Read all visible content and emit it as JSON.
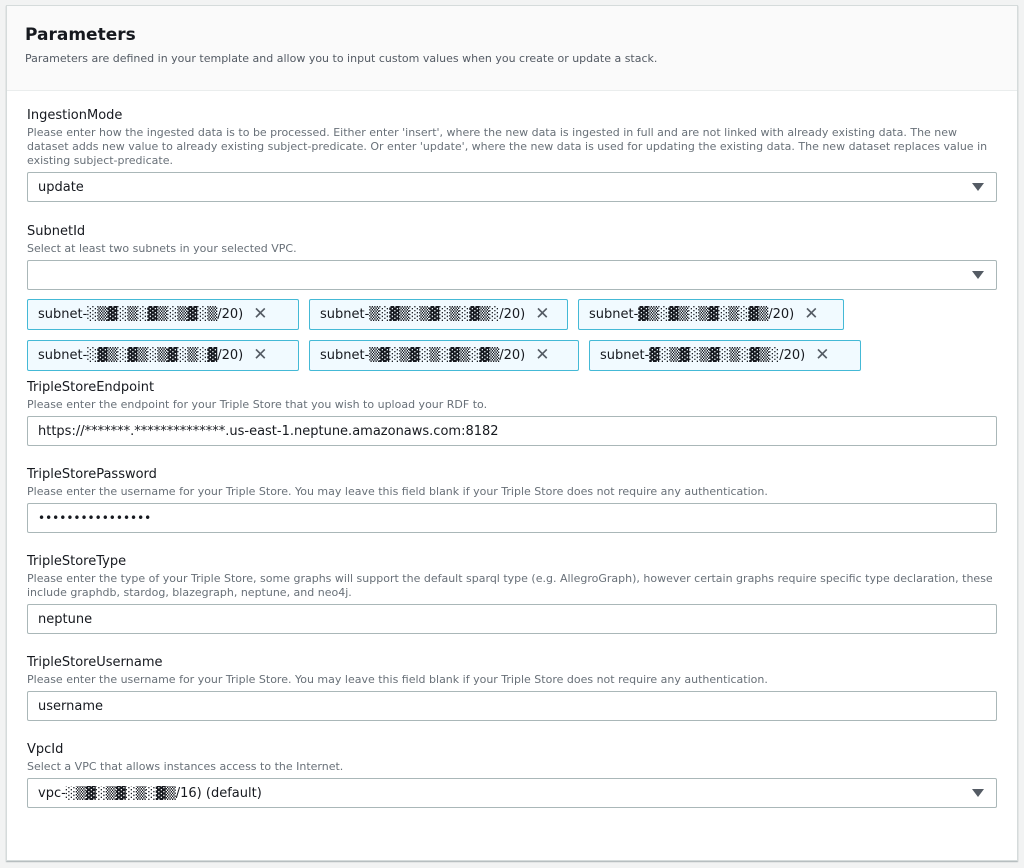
{
  "panel": {
    "title": "Parameters",
    "description": "Parameters are defined in your template and allow you to input custom values when you create or update a stack."
  },
  "fields": {
    "ingestion_mode": {
      "label": "IngestionMode",
      "description": "Please enter how the ingested data is to be processed. Either enter 'insert', where the new data is ingested in full and are not linked with already existing data. The new dataset adds new value to already existing subject-predicate. Or enter 'update', where the new data is used for updating the existing data. The new dataset replaces value in existing subject-predicate.",
      "value": "update"
    },
    "subnet_id": {
      "label": "SubnetId",
      "description": "Select at least two subnets in your selected VPC.",
      "value": "",
      "tokens": [
        "subnet-░▒▓░▒░▓▒░▒▓░▒/20)",
        "subnet-▒░▓▒░▒▓░▒░▓▒░/20)",
        "subnet-▓▒░▓▒░▒▓░▒░▓▒/20)",
        "subnet-░▓▒░▓▒░▒▓░▒░▓/20)",
        "subnet-▒▓░▒▓░▒░▓▒░▓▒/20)",
        "subnet-▓░▒▓░▒▓░▒░▓▒░/20)"
      ]
    },
    "triple_store_endpoint": {
      "label": "TripleStoreEndpoint",
      "description": "Please enter the endpoint for your Triple Store that you wish to upload your RDF to.",
      "value": "https://*******.**************.us-east-1.neptune.amazonaws.com:8182"
    },
    "triple_store_password": {
      "label": "TripleStorePassword",
      "description": "Please enter the username for your Triple Store. You may leave this field blank if your Triple Store does not require any authentication.",
      "value": "••••••••••••••••"
    },
    "triple_store_type": {
      "label": "TripleStoreType",
      "description": "Please enter the type of your Triple Store, some graphs will support the default sparql type (e.g. AllegroGraph), however certain graphs require specific type declaration, these include graphdb, stardog, blazegraph, neptune, and neo4j.",
      "value": "neptune"
    },
    "triple_store_username": {
      "label": "TripleStoreUsername",
      "description": "Please enter the username for your Triple Store. You may leave this field blank if your Triple Store does not require any authentication.",
      "value": "username"
    },
    "vpc_id": {
      "label": "VpcId",
      "description": "Select a VPC that allows instances access to the Internet.",
      "value": "vpc-░▒▓░▒▓░▒░▓▒/16) (default)"
    }
  },
  "icons": {
    "select_caret": "caret-down-icon",
    "token_remove": "close-icon"
  },
  "colors": {
    "token_border": "#44b9d6",
    "token_bg": "#f1faff",
    "input_border": "#aab7b8"
  }
}
